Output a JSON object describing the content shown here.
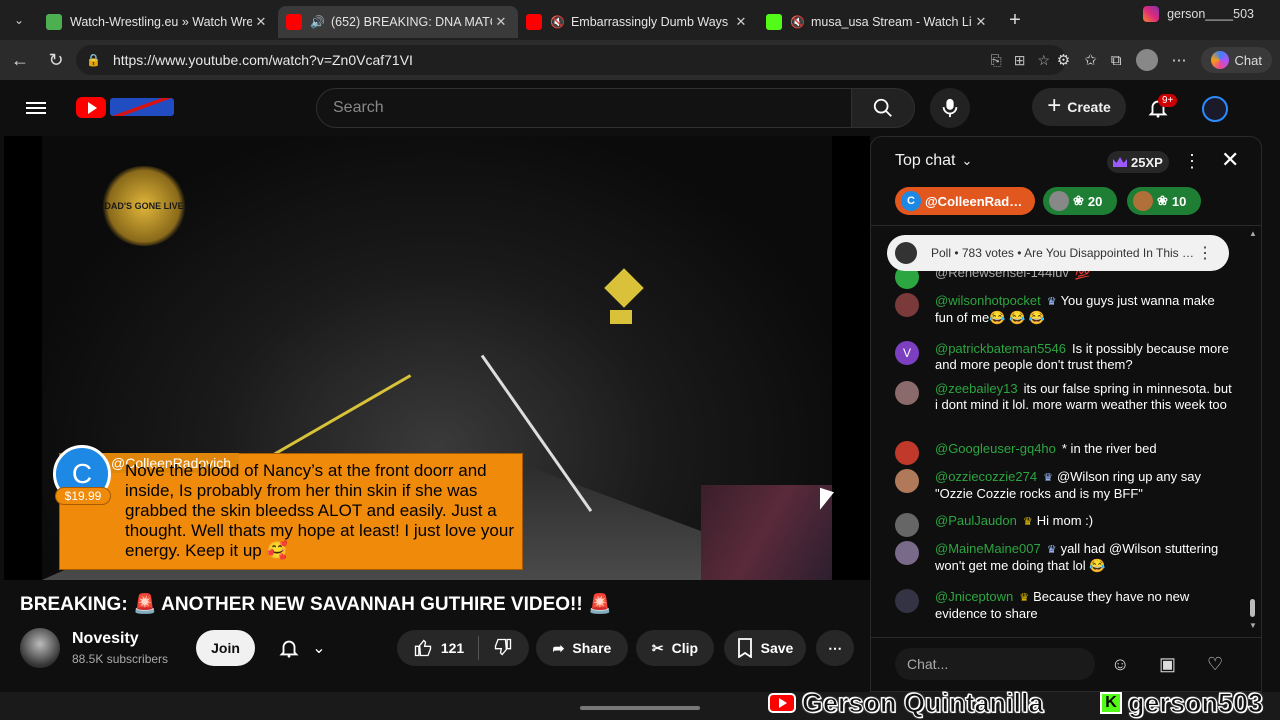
{
  "browser": {
    "tabs": [
      {
        "title": "Watch-Wrestling.eu » Watch Wrestl",
        "favicon_color": "#4caf50",
        "active": false,
        "audio": ""
      },
      {
        "title": "(652) BREAKING: DNA MATCH",
        "favicon_color": "#ff0000",
        "active": true,
        "audio": "🔊"
      },
      {
        "title": "Embarrassingly Dumb Ways Pe",
        "favicon_color": "#ff0000",
        "active": false,
        "audio": "🔇"
      },
      {
        "title": "musa_usa Stream - Watch Live",
        "favicon_color": "#53fc18",
        "active": false,
        "audio": "🔇"
      }
    ],
    "profile_tab": "gerson____503",
    "url": "https://www.youtube.com/watch?v=Zn0Vcaf71VI",
    "copilot_label": "Chat"
  },
  "youtube": {
    "search_placeholder": "Search",
    "create_label": "Create",
    "notif_badge": "9+"
  },
  "video": {
    "logo_text": "DAD'S GONE LIVE",
    "superchat": {
      "author": "@ColleenRadovich",
      "amount": "$19.99",
      "avatar_letter": "C",
      "message": "Nove the blood of Nancy’s at the front doorr and inside, Is probably from her thin skin if she was grabbed the skin bleedss ALOT and easily. Just a thought. Well thats my hope at least! I just love your energy. Keep it up 🥰"
    }
  },
  "title": "BREAKING:  🚨 ANOTHER NEW SAVANNAH GUTHIRE VIDEO!! 🚨",
  "channel": {
    "name": "Novesity",
    "subscribers": "88.5K subscribers",
    "join_label": "Join"
  },
  "actions": {
    "likes": "121",
    "share": "Share",
    "clip": "Clip",
    "save": "Save"
  },
  "chat": {
    "mode": "Top chat",
    "xp": "25XP",
    "tickers": [
      {
        "label": "@ColleenRad…",
        "letter": "C"
      },
      {
        "label": "20"
      },
      {
        "label": "10"
      }
    ],
    "poll": "Poll • 783 votes • Are You Disappointed In This …",
    "messages": [
      {
        "author": "@Renewsensei-144luv",
        "body": "💯",
        "avatar_color": "#2ba640",
        "author_gray": true
      },
      {
        "author": "@wilsonhotpocket",
        "badge": "member",
        "body": "You guys just wanna make fun of me😂 😂 😂",
        "avatar_color": "#7a3a3a"
      },
      {
        "author": "@patrickbateman5546",
        "body": "Is it possibly because more and more people don't trust them?",
        "avatar_color": "#7b3fbf",
        "avatar_letter": "V"
      },
      {
        "author": "@zeebailey13",
        "body": "its our false spring in minnesota. but i dont mind it lol. more warm weather this week too",
        "avatar_color": "#8a6a6a"
      },
      {
        "author": "@Googleuser-gq4ho",
        "body": "* in the river bed",
        "avatar_color": "#c0392b"
      },
      {
        "author": "@ozziecozzie274",
        "badge": "member",
        "body": "@Wilson ring up any say \"Ozzie Cozzie rocks and is my BFF\"",
        "avatar_color": "#b07a5a"
      },
      {
        "author": "@PaulJaudon",
        "badge": "gold",
        "body": "Hi mom :)",
        "avatar_color": "#666"
      },
      {
        "author": "@MaineMaine007",
        "badge": "member",
        "body": "yall had @Wilson stuttering won't get me doing that lol 😂",
        "avatar_color": "#7a6a8a"
      },
      {
        "author": "@Jniceptown",
        "badge": "gold",
        "body": "Because they have no new evidence to share",
        "avatar_color": "#334"
      }
    ],
    "input_placeholder": "Chat..."
  },
  "overlay": {
    "name1": "Gerson Quintanilla",
    "name2": "gerson503"
  }
}
